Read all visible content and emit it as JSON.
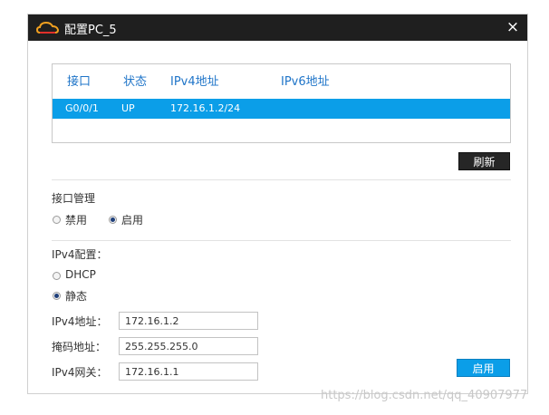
{
  "window": {
    "title": "配置PC_5",
    "close_label": "×"
  },
  "interfaces": {
    "columns": [
      "接口",
      "状态",
      "IPv4地址",
      "IPv6地址"
    ],
    "rows": [
      {
        "interface": "G0/0/1",
        "status": "UP",
        "ipv4": "172.16.1.2/24",
        "ipv6": ""
      }
    ],
    "refresh_label": "刷新"
  },
  "interface_mgmt": {
    "title": "接口管理",
    "options": [
      "禁用",
      "启用"
    ],
    "selected": "启用"
  },
  "ipv4_config": {
    "title": "IPv4配置：",
    "options": [
      "DHCP",
      "静态"
    ],
    "selected": "静态",
    "address_label": "IPv4地址：",
    "address_value": "172.16.1.2",
    "mask_label": "掩码地址：",
    "mask_value": "255.255.255.0",
    "gateway_label": "IPv4网关：",
    "gateway_value": "172.16.1.1",
    "apply_label": "启用"
  },
  "watermark": "https://blog.csdn.net/qq_40907977",
  "colors": {
    "accent": "#0b9ee8",
    "header_text": "#1e74c8",
    "titlebar": "#1f1f1f"
  }
}
